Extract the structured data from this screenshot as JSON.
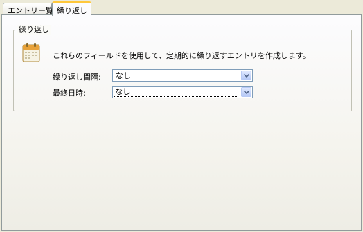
{
  "tabs": [
    {
      "label": "エントリー覧",
      "active": false
    },
    {
      "label": "繰り返し",
      "active": true
    }
  ],
  "group": {
    "title": "繰り返し",
    "description": "これらのフィールドを使用して、定期的に繰り返すエントリを作成します。",
    "icon": "calendar-icon"
  },
  "fields": {
    "interval": {
      "label": "繰り返し間隔:",
      "value": "なし"
    },
    "end_datetime": {
      "label": "最終日時:",
      "value": "なし"
    }
  },
  "colors": {
    "active_tab_accent": "#ffc83c",
    "combo_border": "#7f9db9"
  }
}
